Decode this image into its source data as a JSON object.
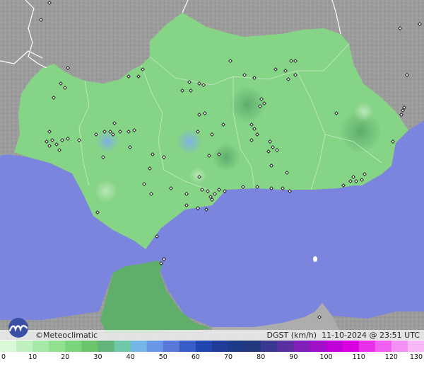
{
  "brand": {
    "copyright": "©",
    "name": "Meteoclimatic"
  },
  "stamp": {
    "variable": "DGST (km/h)",
    "datetime": "11-10-2024 @ 23:51 UTC"
  },
  "legend": {
    "ticks": [
      "0",
      "10",
      "20",
      "30",
      "40",
      "50",
      "60",
      "70",
      "80",
      "90",
      "100",
      "110",
      "120",
      "130"
    ],
    "min": 0,
    "max": 130,
    "colors": [
      "#d8f8d8",
      "#c0f0c0",
      "#a6e8a6",
      "#90e090",
      "#7ad47a",
      "#6ac46a",
      "#62b47a",
      "#6cc8a6",
      "#74b6e6",
      "#6a96e6",
      "#5a78d8",
      "#3a5ec8",
      "#2046b0",
      "#1e3c98",
      "#1c3a88",
      "#243880",
      "#3a3890",
      "#5a30a0",
      "#8020b8",
      "#a010c8",
      "#c000d8",
      "#d800e0",
      "#e830e8",
      "#f060f0",
      "#f490f4",
      "#f8b8f8"
    ]
  },
  "colors": {
    "sea": "#7c85dd",
    "land_outside": "#9a9a9a",
    "region": "#86d486",
    "region_dark": "#6fbf7a",
    "morocco": "#5fae6a",
    "border": "#ffffff",
    "station": "#111111"
  },
  "icons": {
    "logo": "meteoclimatic-logo-icon",
    "station": "station-marker-icon"
  }
}
